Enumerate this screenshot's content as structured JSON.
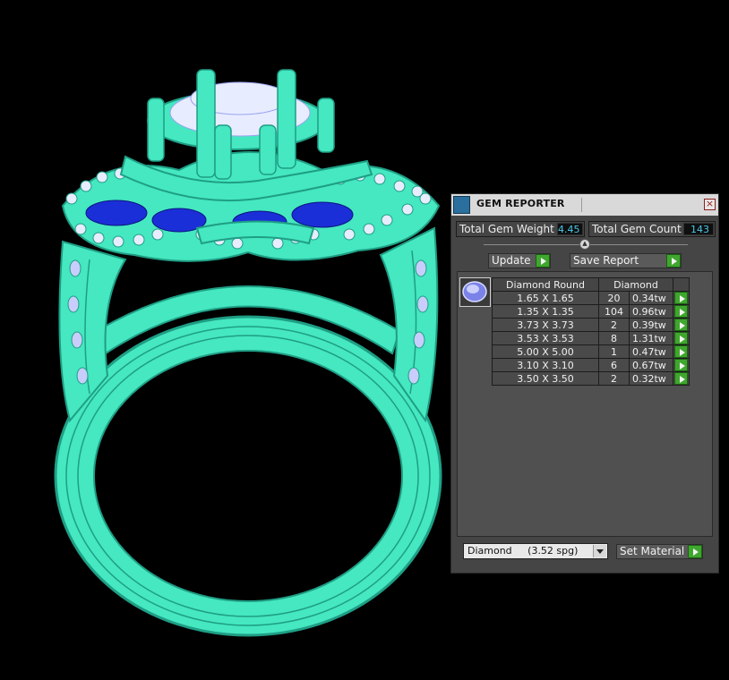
{
  "panel": {
    "title": "GEM REPORTER",
    "total_weight_label": "Total Gem Weight",
    "total_weight_value": "4.45",
    "total_count_label": "Total Gem Count",
    "total_count_value": "143",
    "update_label": "Update",
    "save_label": "Save Report",
    "table": {
      "header_shape": "Diamond Round",
      "header_material": "Diamond",
      "rows": [
        {
          "size": "1.65 X 1.65",
          "count": "20",
          "weight": "0.34tw"
        },
        {
          "size": "1.35 X 1.35",
          "count": "104",
          "weight": "0.96tw"
        },
        {
          "size": "3.73 X 3.73",
          "count": "2",
          "weight": "0.39tw"
        },
        {
          "size": "3.53 X 3.53",
          "count": "8",
          "weight": "1.31tw"
        },
        {
          "size": "5.00 X 5.00",
          "count": "1",
          "weight": "0.47tw"
        },
        {
          "size": "3.10 X 3.10",
          "count": "6",
          "weight": "0.67tw"
        },
        {
          "size": "3.50 X 3.50",
          "count": "2",
          "weight": "0.32tw"
        }
      ]
    },
    "material_value": "Diamond     (3.52 spg)",
    "set_material_label": "Set Material"
  },
  "colors": {
    "ring_metal": "#45e8c0",
    "ring_edge": "#1f9e85",
    "gem_white": "#e8ecff",
    "gem_blue": "#1b2fd8",
    "accent_green": "#3fa62e",
    "value_text": "#48c8e8"
  }
}
